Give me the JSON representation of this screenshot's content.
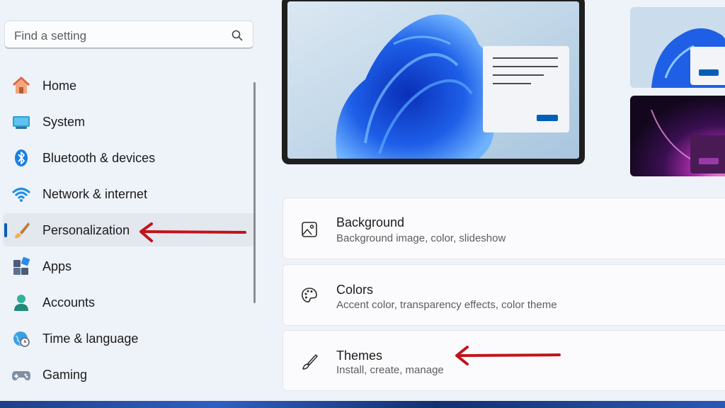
{
  "search": {
    "placeholder": "Find a setting"
  },
  "nav": {
    "items": [
      {
        "label": "Home",
        "icon": "home-icon"
      },
      {
        "label": "System",
        "icon": "monitor-icon"
      },
      {
        "label": "Bluetooth & devices",
        "icon": "bluetooth-icon"
      },
      {
        "label": "Network & internet",
        "icon": "wifi-icon"
      },
      {
        "label": "Personalization",
        "icon": "brush-icon",
        "selected": true
      },
      {
        "label": "Apps",
        "icon": "apps-icon"
      },
      {
        "label": "Accounts",
        "icon": "account-icon"
      },
      {
        "label": "Time & language",
        "icon": "globe-clock-icon"
      },
      {
        "label": "Gaming",
        "icon": "controller-icon"
      }
    ]
  },
  "cards": [
    {
      "title": "Background",
      "subtitle": "Background image, color, slideshow",
      "icon": "image-icon"
    },
    {
      "title": "Colors",
      "subtitle": "Accent color, transparency effects, color theme",
      "icon": "palette-icon"
    },
    {
      "title": "Themes",
      "subtitle": "Install, create, manage",
      "icon": "brush-outline-icon"
    }
  ],
  "colors": {
    "accent": "#005fb8",
    "annotation_arrow": "#c0141c"
  }
}
